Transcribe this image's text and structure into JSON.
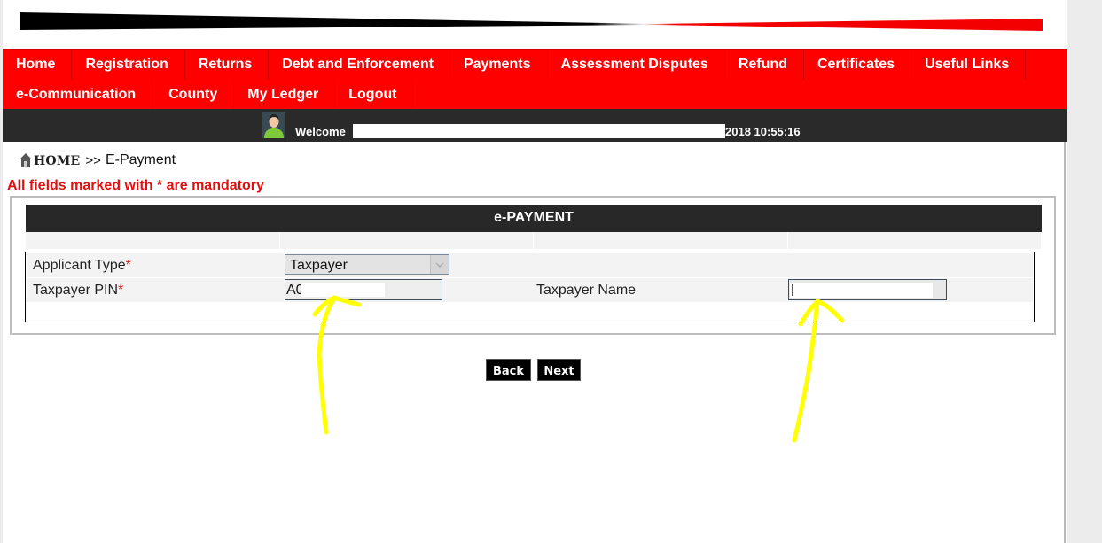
{
  "banner": {
    "decoration": "black-to-red-wedge-stripe"
  },
  "menu": {
    "row1": [
      "Home",
      "Registration",
      "Returns",
      "Debt and Enforcement",
      "Payments",
      "Assessment Disputes",
      "Refund",
      "Certificates",
      "Useful Links"
    ],
    "row2": [
      "e-Communication",
      "County",
      "My Ledger",
      "Logout"
    ]
  },
  "welcome": {
    "avatar_icon": "user-avatar-icon",
    "label": "Welcome",
    "timestamp": "2018 10:55:16"
  },
  "breadcrumb": {
    "home_icon": "house-icon",
    "home": "HOME",
    "separator": ">>",
    "current": "E-Payment"
  },
  "mandatory_note": "All fields marked with * are mandatory",
  "form": {
    "title": "e-PAYMENT",
    "fields": {
      "applicant_type": {
        "label": "Applicant Type",
        "required": "*",
        "value": "Taxpayer"
      },
      "taxpayer_pin": {
        "label": "Taxpayer PIN",
        "required": "*",
        "value": "A0"
      },
      "taxpayer_name": {
        "label": "Taxpayer Name",
        "value": ""
      }
    }
  },
  "buttons": {
    "back": "Back",
    "next": "Next"
  },
  "colors": {
    "menu_bg": "#ff0000",
    "bar_dark": "#2a2a2a",
    "mandatory_text": "#e01010",
    "annotation": "#ffff00"
  }
}
